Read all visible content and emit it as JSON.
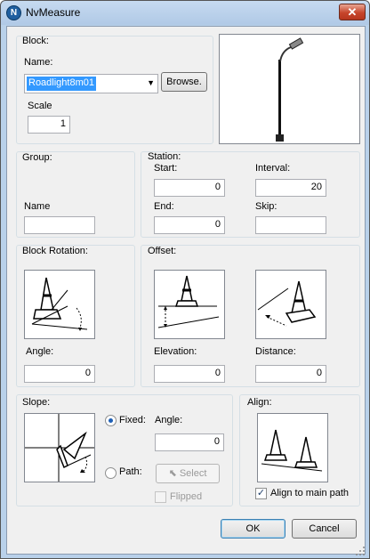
{
  "window": {
    "title": "NvMeasure",
    "app_icon_letter": "N",
    "close_symbol": "✕"
  },
  "block": {
    "group_label": "Block:",
    "name_label": "Name:",
    "name_value": "Roadlight8m01",
    "browse_label": "Browse.",
    "scale_label": "Scale",
    "scale_value": "1"
  },
  "group": {
    "group_label": "Group:",
    "name_label": "Name",
    "name_value": ""
  },
  "station": {
    "group_label": "Station:",
    "start_label": "Start:",
    "start_value": "0",
    "interval_label": "Interval:",
    "interval_value": "20",
    "end_label": "End:",
    "end_value": "0",
    "skip_label": "Skip:",
    "skip_value": ""
  },
  "block_rotation": {
    "group_label": "Block Rotation:",
    "angle_label": "Angle:",
    "angle_value": "0"
  },
  "offset": {
    "group_label": "Offset:",
    "elevation_label": "Elevation:",
    "elevation_value": "0",
    "distance_label": "Distance:",
    "distance_value": "0"
  },
  "slope": {
    "group_label": "Slope:",
    "fixed_label": "Fixed:",
    "fixed_checked": true,
    "angle_label": "Angle:",
    "angle_value": "0",
    "path_label": "Path:",
    "path_checked": false,
    "select_label": "Select",
    "flipped_label": "Flipped",
    "flipped_checked": false
  },
  "align": {
    "group_label": "Align:",
    "align_main_label": "Align to main path",
    "align_main_checked": true,
    "check_glyph": "✓"
  },
  "footer": {
    "ok_label": "OK",
    "cancel_label": "Cancel"
  }
}
